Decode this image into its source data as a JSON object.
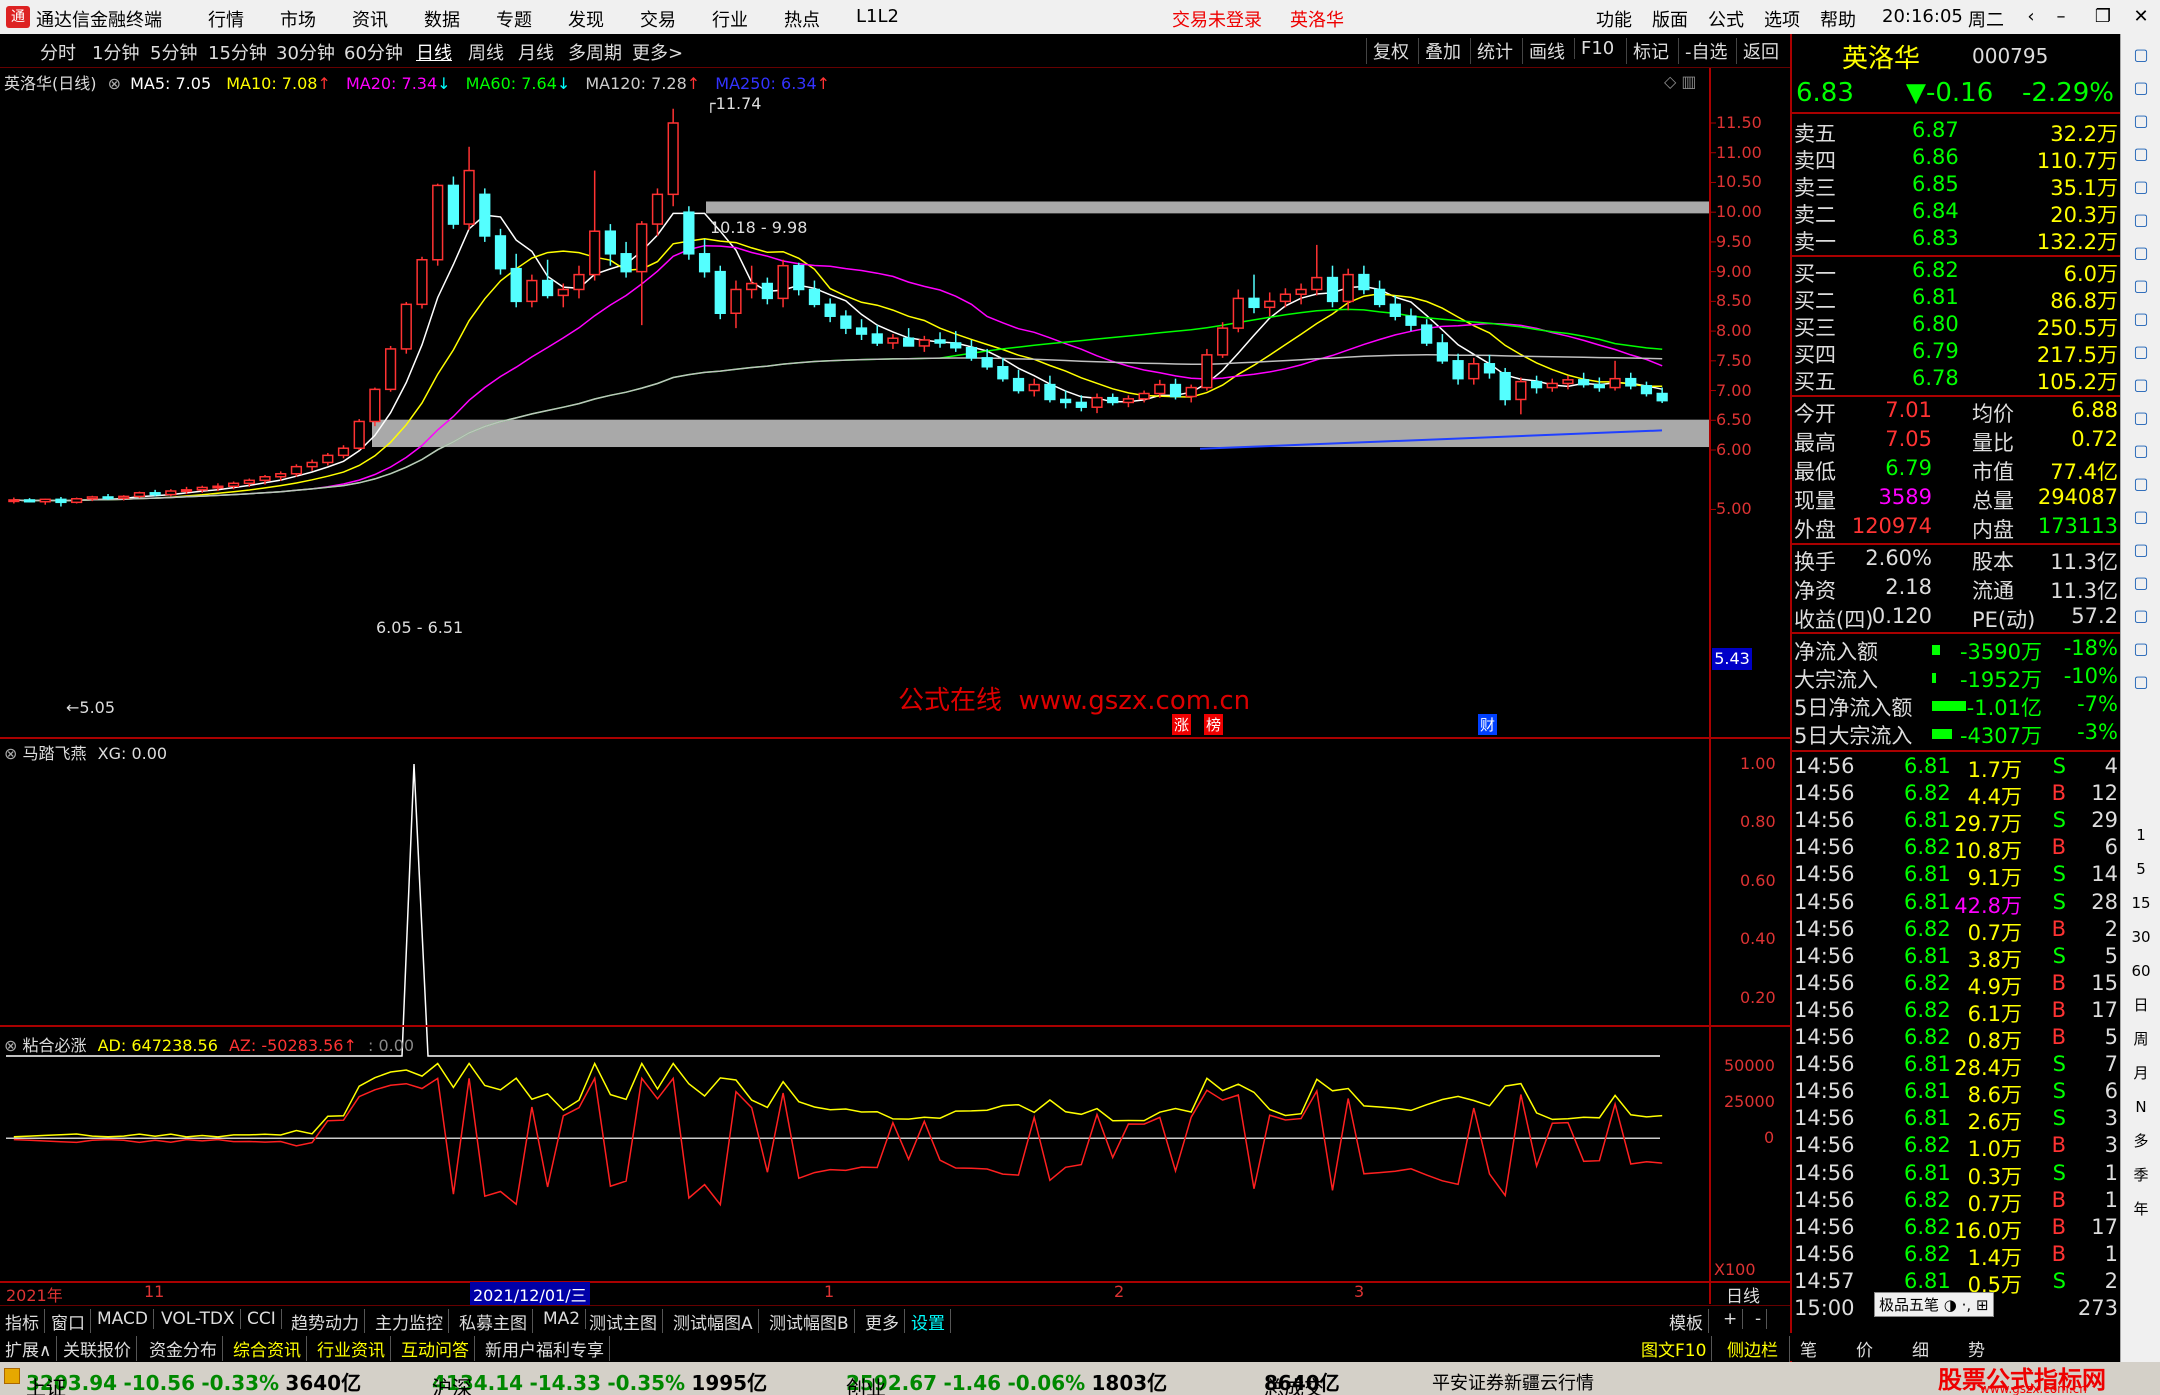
{
  "menubar": {
    "app_title": "通达信金融终端",
    "menus": [
      "行情",
      "市场",
      "资讯",
      "数据",
      "专题",
      "发现",
      "交易",
      "行业",
      "热点",
      "L1L2"
    ],
    "login_status": "交易未登录",
    "stock_name": "英洛华",
    "right_menus": [
      "功能",
      "版面",
      "公式",
      "选项",
      "帮助"
    ],
    "clock": "20:16:05",
    "weekday": "周二"
  },
  "periodbar": {
    "periods": [
      "分时",
      "1分钟",
      "5分钟",
      "15分钟",
      "30分钟",
      "60分钟",
      "日线",
      "周线",
      "月线",
      "多周期",
      "更多>"
    ],
    "active_period": "日线",
    "tools": [
      "复权",
      "叠加",
      "统计",
      "画线",
      "F10",
      "标记",
      "-自选",
      "返回"
    ]
  },
  "main_chart": {
    "title": "英洛华(日线)",
    "ma": [
      {
        "label": "MA5: 7.05",
        "color": "#ffffff"
      },
      {
        "label": "MA10: 7.08",
        "color": "#ffff00"
      },
      {
        "label": "MA20: 7.34",
        "color": "#ff00ff"
      },
      {
        "label": "MA60: 7.64",
        "color": "#00ff00"
      },
      {
        "label": "MA120: 7.28",
        "color": "#c0c0c0"
      },
      {
        "label": "MA250: 6.34",
        "color": "#0000ff"
      }
    ],
    "y_ticks": [
      "11.50",
      "11.00",
      "10.50",
      "10.00",
      "9.50",
      "9.00",
      "8.50",
      "8.00",
      "7.50",
      "7.00",
      "6.50",
      "6.00",
      "5.00"
    ],
    "current_price_tag": "5.43",
    "annotations": {
      "high": "11.74",
      "low": "5.05",
      "zone_top": "10.18 - 9.98",
      "zone_bottom": "6.05 - 6.51"
    },
    "watermark": "公式在线  www.gszx.com.cn",
    "event_marks": [
      "涨",
      "榜",
      "财"
    ]
  },
  "indicator1": {
    "title": "马踏飞燕",
    "value": "XG: 0.00",
    "y_ticks": [
      "1.00",
      "0.80",
      "0.60",
      "0.40",
      "0.20"
    ]
  },
  "indicator2": {
    "title": "粘合必涨",
    "ad": "AD: 647238.56",
    "az": "AZ: -50283.56",
    "extra": ": 0.00",
    "y_ticks": [
      "50000",
      "25000",
      "0"
    ]
  },
  "time_axis": {
    "labels": [
      "2021年",
      "11",
      "2021/12/01/三",
      "1",
      "2",
      "3"
    ],
    "scale": "X100",
    "period_label": "日线"
  },
  "bottom_tabs": [
    "指标",
    "窗口",
    "MACD",
    "VOL-TDX",
    "CCI",
    "趋势动力",
    "主力监控",
    "私募主图",
    "MA2",
    "测试主图",
    "测试幅图A",
    "测试幅图B",
    "更多",
    "设置"
  ],
  "bottom_tabs_active": "设置",
  "bottom_right": [
    "模板",
    "+",
    "-"
  ],
  "bottom_tabs2": [
    "扩展∧",
    "关联报价",
    "资金分布",
    "综合资讯",
    "行业资讯",
    "互动问答",
    "新用户福利专享"
  ],
  "bottom_right2": [
    "图文F10",
    "侧边栏《",
    "笔",
    "价",
    "细",
    "势"
  ],
  "quote": {
    "name": "英洛华",
    "code": "000795",
    "price": "6.83",
    "change": "▼-0.16",
    "pct": "-2.29%",
    "asks": [
      {
        "label": "卖五",
        "price": "6.87",
        "vol": "32.2万"
      },
      {
        "label": "卖四",
        "price": "6.86",
        "vol": "110.7万"
      },
      {
        "label": "卖三",
        "price": "6.85",
        "vol": "35.1万"
      },
      {
        "label": "卖二",
        "price": "6.84",
        "vol": "20.3万"
      },
      {
        "label": "卖一",
        "price": "6.83",
        "vol": "132.2万"
      }
    ],
    "bids": [
      {
        "label": "买一",
        "price": "6.82",
        "vol": "6.0万"
      },
      {
        "label": "买二",
        "price": "6.81",
        "vol": "86.8万"
      },
      {
        "label": "买三",
        "price": "6.80",
        "vol": "250.5万"
      },
      {
        "label": "买四",
        "price": "6.79",
        "vol": "217.5万"
      },
      {
        "label": "买五",
        "price": "6.78",
        "vol": "105.2万"
      }
    ],
    "stats": [
      {
        "l1": "今开",
        "v1": "7.01",
        "c1": "#ff3333",
        "l2": "均价",
        "v2": "6.88",
        "c2": "#ffff00"
      },
      {
        "l1": "最高",
        "v1": "7.05",
        "c1": "#ff3333",
        "l2": "量比",
        "v2": "0.72",
        "c2": "#ffff00"
      },
      {
        "l1": "最低",
        "v1": "6.79",
        "c1": "#00ff00",
        "l2": "市值",
        "v2": "77.4亿",
        "c2": "#ffff00"
      },
      {
        "l1": "现量",
        "v1": "3589",
        "c1": "#ff00ff",
        "l2": "总量",
        "v2": "294087",
        "c2": "#ffff00"
      },
      {
        "l1": "外盘",
        "v1": "120974",
        "c1": "#ff3333",
        "l2": "内盘",
        "v2": "173113",
        "c2": "#00ff00"
      }
    ],
    "stats2": [
      {
        "l1": "换手",
        "v1": "2.60%",
        "l2": "股本",
        "v2": "11.3亿"
      },
      {
        "l1": "净资",
        "v1": "2.18",
        "l2": "流通",
        "v2": "11.3亿"
      },
      {
        "l1": "收益(四)",
        "v1": "0.120",
        "l2": "PE(动)",
        "v2": "57.2"
      }
    ],
    "flows": [
      {
        "label": "净流入额",
        "val": "-3590万",
        "pct": "-18%",
        "bar": 8
      },
      {
        "label": "大宗流入",
        "val": "-1952万",
        "pct": "-10%",
        "bar": 4
      },
      {
        "label": "5日净流入额",
        "val": "-1.01亿",
        "pct": "-7%",
        "bar": 34
      },
      {
        "label": "5日大宗流入",
        "val": "-4307万",
        "pct": "-3%",
        "bar": 20
      }
    ],
    "ticks": [
      {
        "t": "14:56",
        "p": "6.81",
        "v": "1.7万",
        "d": "S",
        "n": "4"
      },
      {
        "t": "14:56",
        "p": "6.82",
        "v": "4.4万",
        "d": "B",
        "n": "12"
      },
      {
        "t": "14:56",
        "p": "6.81",
        "v": "29.7万",
        "d": "S",
        "n": "29"
      },
      {
        "t": "14:56",
        "p": "6.82",
        "v": "10.8万",
        "d": "B",
        "n": "6"
      },
      {
        "t": "14:56",
        "p": "6.81",
        "v": "9.1万",
        "d": "S",
        "n": "14"
      },
      {
        "t": "14:56",
        "p": "6.81",
        "v": "42.8万",
        "d": "S",
        "n": "28"
      },
      {
        "t": "14:56",
        "p": "6.82",
        "v": "0.7万",
        "d": "B",
        "n": "2"
      },
      {
        "t": "14:56",
        "p": "6.81",
        "v": "3.8万",
        "d": "S",
        "n": "5"
      },
      {
        "t": "14:56",
        "p": "6.82",
        "v": "4.9万",
        "d": "B",
        "n": "15"
      },
      {
        "t": "14:56",
        "p": "6.82",
        "v": "6.1万",
        "d": "B",
        "n": "17"
      },
      {
        "t": "14:56",
        "p": "6.82",
        "v": "0.8万",
        "d": "B",
        "n": "5"
      },
      {
        "t": "14:56",
        "p": "6.81",
        "v": "28.4万",
        "d": "S",
        "n": "7"
      },
      {
        "t": "14:56",
        "p": "6.81",
        "v": "8.6万",
        "d": "S",
        "n": "6"
      },
      {
        "t": "14:56",
        "p": "6.81",
        "v": "2.6万",
        "d": "S",
        "n": "3"
      },
      {
        "t": "14:56",
        "p": "6.82",
        "v": "1.0万",
        "d": "B",
        "n": "3"
      },
      {
        "t": "14:56",
        "p": "6.81",
        "v": "0.3万",
        "d": "S",
        "n": "1"
      },
      {
        "t": "14:56",
        "p": "6.82",
        "v": "0.7万",
        "d": "B",
        "n": "1"
      },
      {
        "t": "14:56",
        "p": "6.82",
        "v": "16.0万",
        "d": "B",
        "n": "17"
      },
      {
        "t": "14:56",
        "p": "6.82",
        "v": "1.4万",
        "d": "B",
        "n": "1"
      },
      {
        "t": "14:57",
        "p": "6.81",
        "v": "0.5万",
        "d": "S",
        "n": "2"
      },
      {
        "t": "15:00",
        "p": "",
        "v": "",
        "d": "",
        "n": "273"
      }
    ],
    "tick_toolbar": "极品五笔"
  },
  "sidebar_right_labels": [
    "1",
    "5",
    "15",
    "30",
    "60",
    "日",
    "周",
    "月",
    "N",
    "多",
    "季",
    "年"
  ],
  "statusbar": {
    "items": [
      {
        "name": "上证",
        "val": "3203.94",
        "chg": "-10.56",
        "pct": "-0.33%",
        "amt": "3640亿"
      },
      {
        "name": "沪深",
        "val": "4134.14",
        "chg": "-14.33",
        "pct": "-0.35%",
        "amt": "1995亿"
      },
      {
        "name": "创业",
        "val": "2592.67",
        "chg": "-1.46",
        "pct": "-0.06%",
        "amt": "1803亿"
      }
    ],
    "total_label": "总成交",
    "total_val": "8640亿",
    "broker": "平安证券新疆云行情",
    "brand": "股票公式指标网",
    "brand_url": "www.gszx.com.cn"
  },
  "chart_data": {
    "type": "candlestick",
    "y_range": [
      5.0,
      11.9
    ],
    "candles": [
      [
        5.14,
        5.2,
        5.1,
        5.16
      ],
      [
        5.16,
        5.19,
        5.12,
        5.13
      ],
      [
        5.13,
        5.18,
        5.08,
        5.17
      ],
      [
        5.17,
        5.21,
        5.05,
        5.12
      ],
      [
        5.12,
        5.2,
        5.1,
        5.18
      ],
      [
        5.18,
        5.23,
        5.14,
        5.21
      ],
      [
        5.21,
        5.26,
        5.16,
        5.19
      ],
      [
        5.19,
        5.24,
        5.15,
        5.22
      ],
      [
        5.22,
        5.3,
        5.19,
        5.28
      ],
      [
        5.28,
        5.33,
        5.22,
        5.25
      ],
      [
        5.25,
        5.34,
        5.22,
        5.31
      ],
      [
        5.31,
        5.38,
        5.26,
        5.33
      ],
      [
        5.33,
        5.4,
        5.28,
        5.37
      ],
      [
        5.37,
        5.44,
        5.31,
        5.39
      ],
      [
        5.39,
        5.47,
        5.34,
        5.44
      ],
      [
        5.44,
        5.52,
        5.38,
        5.49
      ],
      [
        5.49,
        5.58,
        5.42,
        5.55
      ],
      [
        5.55,
        5.64,
        5.48,
        5.6
      ],
      [
        5.6,
        5.76,
        5.55,
        5.72
      ],
      [
        5.72,
        5.84,
        5.65,
        5.79
      ],
      [
        5.79,
        5.95,
        5.74,
        5.91
      ],
      [
        5.91,
        6.08,
        5.86,
        6.03
      ],
      [
        6.03,
        6.52,
        6.0,
        6.48
      ],
      [
        6.48,
        7.05,
        6.4,
        7.02
      ],
      [
        7.02,
        7.75,
        6.98,
        7.7
      ],
      [
        7.7,
        8.49,
        7.62,
        8.45
      ],
      [
        8.45,
        9.25,
        8.38,
        9.2
      ],
      [
        9.2,
        10.48,
        9.1,
        10.45
      ],
      [
        10.45,
        10.6,
        9.72,
        9.8
      ],
      [
        9.8,
        11.1,
        9.7,
        10.7
      ],
      [
        10.3,
        10.4,
        9.5,
        9.6
      ],
      [
        9.6,
        9.72,
        8.95,
        9.05
      ],
      [
        9.05,
        9.3,
        8.4,
        8.5
      ],
      [
        8.5,
        8.95,
        8.4,
        8.85
      ],
      [
        8.85,
        9.2,
        8.55,
        8.6
      ],
      [
        8.6,
        8.8,
        8.4,
        8.7
      ],
      [
        8.7,
        9.1,
        8.55,
        8.95
      ],
      [
        8.95,
        10.7,
        8.85,
        9.68
      ],
      [
        9.68,
        9.8,
        9.1,
        9.3
      ],
      [
        9.3,
        9.5,
        8.9,
        9.0
      ],
      [
        9.0,
        9.85,
        8.1,
        9.8
      ],
      [
        9.8,
        10.4,
        9.6,
        10.3
      ],
      [
        10.3,
        11.74,
        10.1,
        11.5
      ],
      [
        10.0,
        10.1,
        9.2,
        9.3
      ],
      [
        9.3,
        9.55,
        8.9,
        9.0
      ],
      [
        9.0,
        9.1,
        8.2,
        8.3
      ],
      [
        8.3,
        8.85,
        8.05,
        8.7
      ],
      [
        8.7,
        9.1,
        8.55,
        8.8
      ],
      [
        8.8,
        8.9,
        8.45,
        8.55
      ],
      [
        8.55,
        9.2,
        8.4,
        9.1
      ],
      [
        9.1,
        9.15,
        8.6,
        8.7
      ],
      [
        8.7,
        8.85,
        8.4,
        8.45
      ],
      [
        8.45,
        8.55,
        8.15,
        8.25
      ],
      [
        8.25,
        8.35,
        7.95,
        8.05
      ],
      [
        8.05,
        8.2,
        7.85,
        7.95
      ],
      [
        7.95,
        8.1,
        7.75,
        7.8
      ],
      [
        7.8,
        7.95,
        7.7,
        7.88
      ],
      [
        7.88,
        8.05,
        7.8,
        7.75
      ],
      [
        7.75,
        7.92,
        7.65,
        7.85
      ],
      [
        7.85,
        7.98,
        7.72,
        7.8
      ],
      [
        7.8,
        8.0,
        7.65,
        7.72
      ],
      [
        7.72,
        7.85,
        7.5,
        7.55
      ],
      [
        7.55,
        7.7,
        7.35,
        7.4
      ],
      [
        7.4,
        7.55,
        7.15,
        7.2
      ],
      [
        7.2,
        7.35,
        6.95,
        7.0
      ],
      [
        7.0,
        7.2,
        6.9,
        7.1
      ],
      [
        7.1,
        7.25,
        6.8,
        6.85
      ],
      [
        6.85,
        7.0,
        6.7,
        6.8
      ],
      [
        6.8,
        6.92,
        6.65,
        6.72
      ],
      [
        6.72,
        6.95,
        6.62,
        6.88
      ],
      [
        6.88,
        6.95,
        6.75,
        6.8
      ],
      [
        6.8,
        6.92,
        6.72,
        6.86
      ],
      [
        6.86,
        7.0,
        6.8,
        6.95
      ],
      [
        6.95,
        7.18,
        6.88,
        7.1
      ],
      [
        7.1,
        7.2,
        6.85,
        6.9
      ],
      [
        6.9,
        7.1,
        6.8,
        7.05
      ],
      [
        7.05,
        7.7,
        7.0,
        7.6
      ],
      [
        7.6,
        8.15,
        7.55,
        8.05
      ],
      [
        8.05,
        8.7,
        7.98,
        8.55
      ],
      [
        8.55,
        8.95,
        8.3,
        8.4
      ],
      [
        8.4,
        8.65,
        8.25,
        8.5
      ],
      [
        8.5,
        8.72,
        8.4,
        8.62
      ],
      [
        8.62,
        8.8,
        8.45,
        8.7
      ],
      [
        8.7,
        9.45,
        8.6,
        8.9
      ],
      [
        8.9,
        9.1,
        8.4,
        8.5
      ],
      [
        8.5,
        9.05,
        8.35,
        8.95
      ],
      [
        8.95,
        9.1,
        8.62,
        8.7
      ],
      [
        8.7,
        8.85,
        8.4,
        8.45
      ],
      [
        8.45,
        8.6,
        8.18,
        8.25
      ],
      [
        8.25,
        8.38,
        8.0,
        8.1
      ],
      [
        8.1,
        8.2,
        7.75,
        7.8
      ],
      [
        7.8,
        7.95,
        7.45,
        7.5
      ],
      [
        7.5,
        7.62,
        7.1,
        7.2
      ],
      [
        7.2,
        7.55,
        7.1,
        7.45
      ],
      [
        7.45,
        7.6,
        7.2,
        7.3
      ],
      [
        7.3,
        7.38,
        6.75,
        6.85
      ],
      [
        6.85,
        7.22,
        6.6,
        7.15
      ],
      [
        7.15,
        7.25,
        6.95,
        7.05
      ],
      [
        7.05,
        7.2,
        6.98,
        7.12
      ],
      [
        7.12,
        7.25,
        7.02,
        7.18
      ],
      [
        7.18,
        7.3,
        7.05,
        7.1
      ],
      [
        7.1,
        7.22,
        6.98,
        7.05
      ],
      [
        7.05,
        7.5,
        7.0,
        7.2
      ],
      [
        7.2,
        7.3,
        7.02,
        7.08
      ],
      [
        7.08,
        7.15,
        6.9,
        6.95
      ],
      [
        6.95,
        7.05,
        6.79,
        6.83
      ]
    ],
    "indicator1_spike": {
      "index": 22,
      "value": 1.0
    },
    "indicator2_range": [
      -75000,
      60000
    ]
  }
}
